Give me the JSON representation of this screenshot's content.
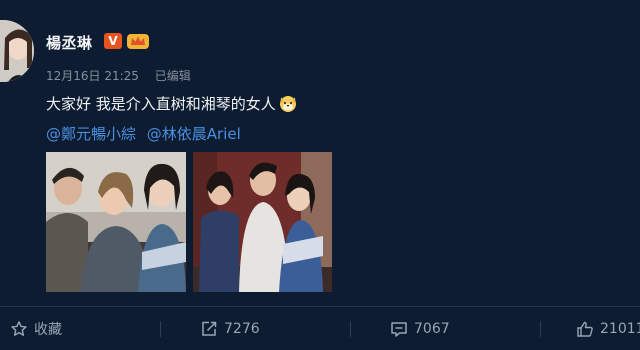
{
  "user": {
    "name": "楊丞琳",
    "verified_badge": "V",
    "vip_badge": "crown-badge-icon"
  },
  "post": {
    "date": "12月16日 21:25",
    "edited": "已编辑",
    "text": "大家好 我是介入直树和湘琴的女人",
    "emoji": "dog-face-emoji-icon",
    "mentions": [
      "@鄭元暢小綜",
      "@林依晨Ariel"
    ]
  },
  "actions": {
    "favorite": {
      "icon": "star-icon",
      "label": "收藏"
    },
    "repost": {
      "icon": "repost-icon",
      "count": "7276"
    },
    "comment": {
      "icon": "comment-icon",
      "count": "7067"
    },
    "like": {
      "icon": "thumbs-up-icon",
      "count": "21011"
    }
  },
  "colors": {
    "background": "#0d1c30",
    "mention": "#4a8fe0",
    "muted": "#8590a0",
    "verified": "#e8541e"
  }
}
